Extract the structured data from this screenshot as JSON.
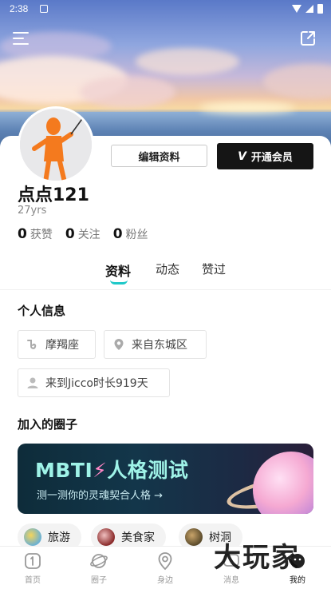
{
  "status_bar": {
    "time": "2:38"
  },
  "profile": {
    "name": "点点121",
    "age": "27yrs",
    "edit_label": "编辑资料",
    "vip_label": "开通会员",
    "stats": [
      {
        "num": "0",
        "label": "获赞"
      },
      {
        "num": "0",
        "label": "关注"
      },
      {
        "num": "0",
        "label": "粉丝"
      }
    ]
  },
  "tabs": [
    {
      "label": "资料",
      "active": true
    },
    {
      "label": "动态",
      "active": false
    },
    {
      "label": "赞过",
      "active": false
    }
  ],
  "personal_info": {
    "title": "个人信息",
    "items": [
      {
        "icon": "zodiac-icon",
        "text": "摩羯座"
      },
      {
        "icon": "location-icon",
        "text": "来自东城区"
      },
      {
        "icon": "user-icon",
        "text": "来到Jicco时长919天"
      }
    ]
  },
  "circles": {
    "title": "加入的圈子",
    "banner": {
      "title_a": "MBTI",
      "title_b": "人格测试",
      "subtitle": "测一测你的灵魂契合人格 →"
    },
    "items": [
      {
        "name": "旅游"
      },
      {
        "name": "美食家"
      },
      {
        "name": "树洞"
      }
    ]
  },
  "bottom_nav": [
    {
      "label": "首页",
      "active": false
    },
    {
      "label": "圈子",
      "active": false
    },
    {
      "label": "身边",
      "active": false
    },
    {
      "label": "消息",
      "active": false
    },
    {
      "label": "我的",
      "active": true
    }
  ],
  "watermark": "大玩家",
  "colors": {
    "accent": "#1ec8c8",
    "vip_bg": "#151515",
    "banner_text": "#9ff3e8",
    "banner_pink": "#ff86c6"
  }
}
